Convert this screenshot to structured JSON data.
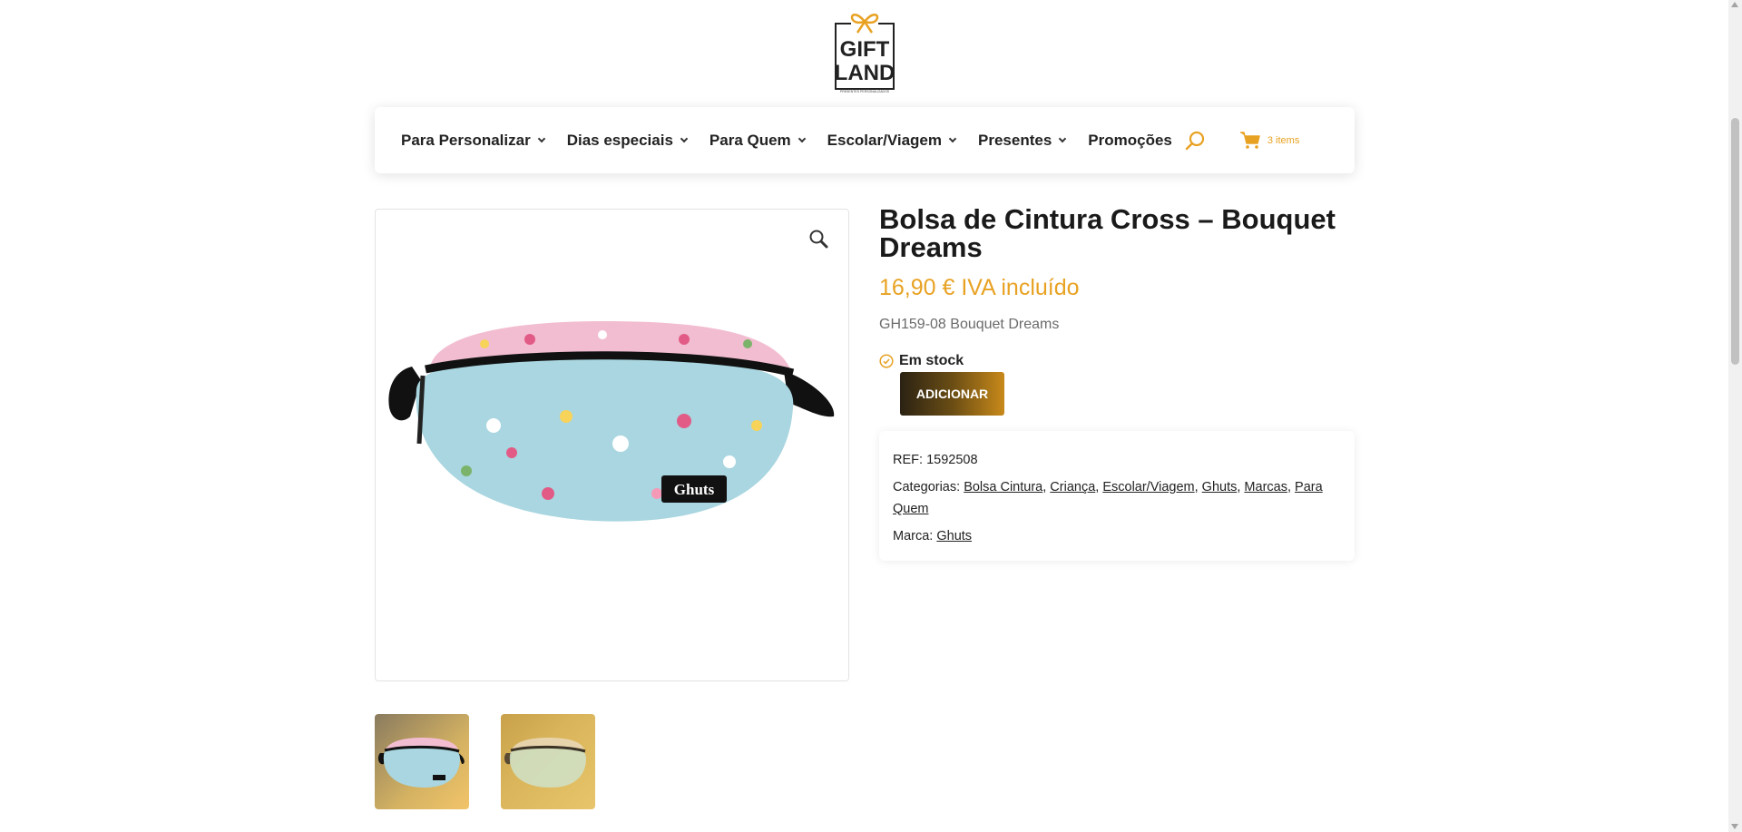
{
  "brand": {
    "logo_line1": "GIFT",
    "logo_line2": "LAND",
    "logo_tagline": "PRESENTES PERSONALIZADOS",
    "accent_color": "#e8a223"
  },
  "nav": {
    "items": [
      {
        "label": "Para Personalizar",
        "has_dropdown": true
      },
      {
        "label": "Dias especiais",
        "has_dropdown": true
      },
      {
        "label": "Para Quem",
        "has_dropdown": true
      },
      {
        "label": "Escolar/Viagem",
        "has_dropdown": true
      },
      {
        "label": "Presentes",
        "has_dropdown": true
      },
      {
        "label": "Promoções",
        "has_dropdown": false
      }
    ],
    "search_icon": "search-icon",
    "cart_icon": "cart-icon",
    "cart_count": "3 items"
  },
  "product": {
    "title": "Bolsa de Cintura Cross – Bouquet Dreams",
    "price": "16,90 € IVA incluído",
    "variant": "GH159-08 Bouquet Dreams",
    "stock": "Em stock",
    "add_button": "ADICIONAR",
    "image_brand_label": "Ghuts",
    "zoom_icon": "magnifier-icon",
    "thumbnails": [
      "bag-thumbnail-1",
      "bag-thumbnail-2"
    ]
  },
  "meta": {
    "ref_label": "REF:",
    "ref_value": "1592508",
    "categories_label": "Categorias:",
    "categories": [
      "Bolsa Cintura",
      "Criança",
      "Escolar/Viagem",
      "Ghuts",
      "Marcas",
      "Para Quem"
    ],
    "brand_label": "Marca:",
    "brand_value": "Ghuts"
  }
}
